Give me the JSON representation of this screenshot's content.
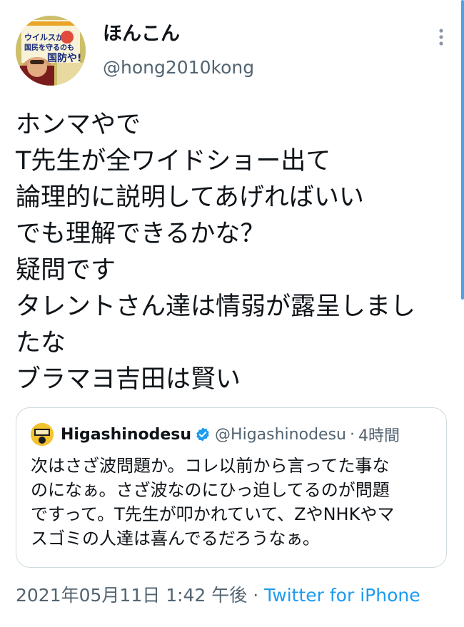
{
  "author": {
    "display_name": "ほんこん",
    "handle": "@hong2010kong",
    "avatar_book_title": "ウイルスから国民を守るのも国防や!"
  },
  "tweet": {
    "lines": [
      "ホンマやで",
      "T先生が全ワイドショー出て",
      "論理的に説明してあげればいい",
      "でも理解できるかな？",
      "疑問です",
      "タレントさん達は情弱が露呈しまし",
      "たな",
      "ブラマヨ吉田は賢い"
    ],
    "timestamp": "2021年05月11日 1:42 午後",
    "separator": "·",
    "source": "Twitter for iPhone"
  },
  "quoted_tweet": {
    "display_name": "Higashinodesu",
    "verified": true,
    "handle": "@Higashinodesu",
    "separator": "·",
    "time": "4時間",
    "lines": [
      "次はさざ波問題か。コレ以前から言ってた事な",
      "のになぁ。さざ波なのにひっ迫してるのが問題",
      "ですって。T先生が叩かれていて、ZやNHKやマ",
      "スゴミの人達は喜んでるだろうなぁ。"
    ]
  },
  "icons": {
    "more": "more-vertical-icon",
    "verified": "verified-badge-icon"
  },
  "colors": {
    "link": "#1d9bf0",
    "secondary_text": "#536471",
    "border": "#cfd9de",
    "verified": "#1d9bf0"
  }
}
